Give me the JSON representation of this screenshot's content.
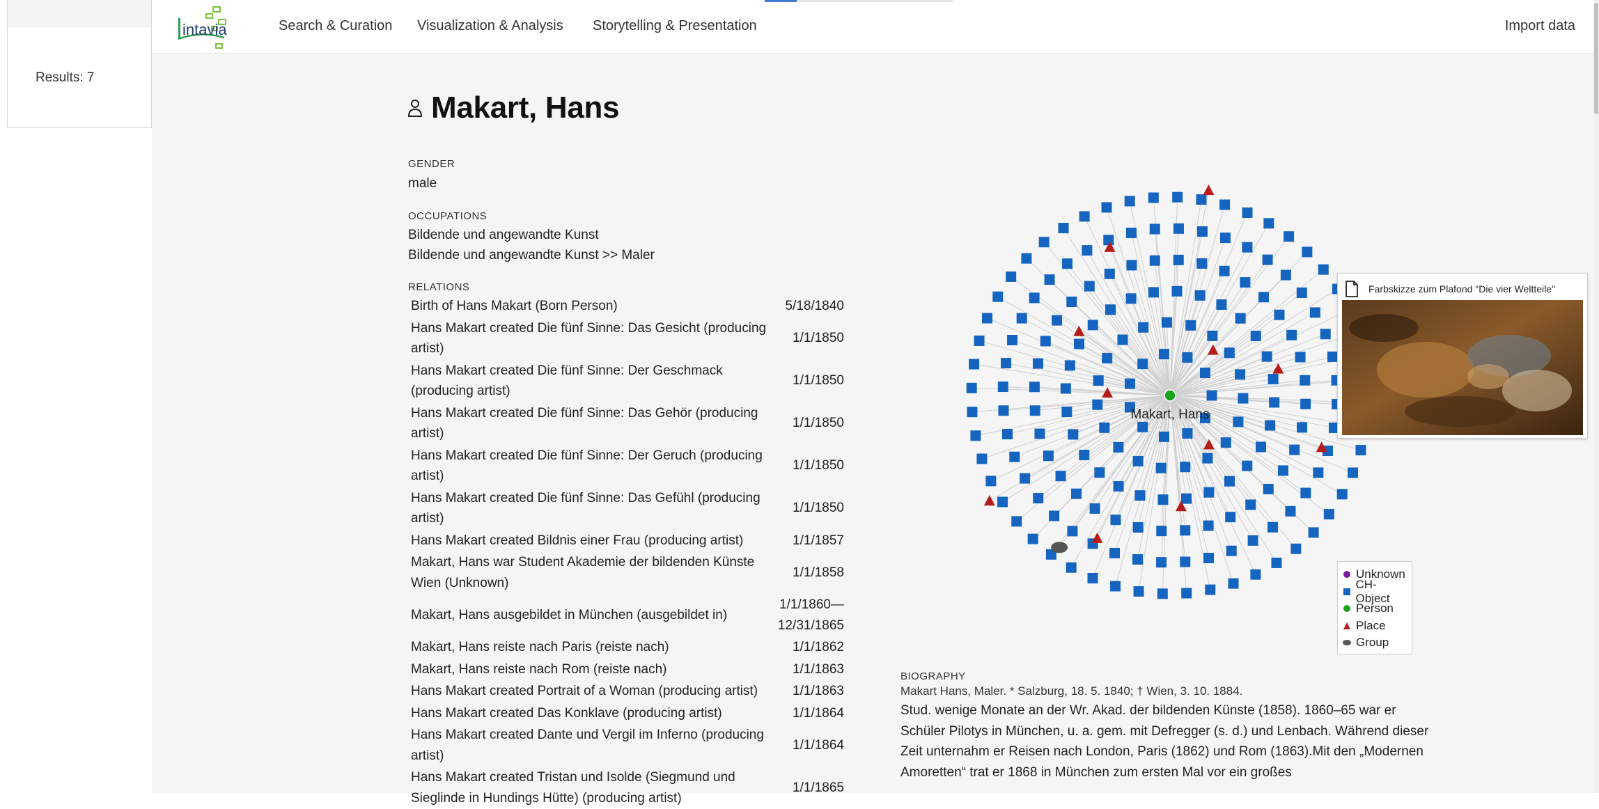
{
  "results_panel": {
    "results_text": "Results: 7"
  },
  "nav": {
    "logo_text": "intavia",
    "links": [
      "Search & Curation",
      "Visualization & Analysis",
      "Storytelling & Presentation"
    ],
    "import_label": "Import data",
    "progress_fraction": 0.17
  },
  "entity": {
    "icon": "person-icon",
    "title": "Makart, Hans",
    "gender_label": "GENDER",
    "gender": "male",
    "occupations_label": "OCCUPATIONS",
    "occupations": [
      "Bildende und angewandte Kunst",
      "Bildende und angewandte Kunst >> Maler"
    ],
    "relations_label": "RELATIONS",
    "relations": [
      {
        "text": "Birth of Hans Makart (Born Person)",
        "date": "5/18/1840"
      },
      {
        "text": "Hans Makart created Die fünf Sinne: Das Gesicht (producing artist)",
        "date": "1/1/1850"
      },
      {
        "text": "Hans Makart created Die fünf Sinne: Der Geschmack (producing artist)",
        "date": "1/1/1850"
      },
      {
        "text": "Hans Makart created Die fünf Sinne: Das Gehör (producing artist)",
        "date": "1/1/1850"
      },
      {
        "text": "Hans Makart created Die fünf Sinne: Der Geruch (producing artist)",
        "date": "1/1/1850"
      },
      {
        "text": "Hans Makart created Die fünf Sinne: Das Gefühl (producing artist)",
        "date": "1/1/1850"
      },
      {
        "text": "Hans Makart created Bildnis einer Frau (producing artist)",
        "date": "1/1/1857"
      },
      {
        "text": "Makart, Hans war Student Akademie der bildenden Künste Wien (Unknown)",
        "date": "1/1/1858"
      },
      {
        "text": "Makart, Hans ausgebildet in München (ausgebildet in)",
        "date": "1/1/1860—\n12/31/1865"
      },
      {
        "text": "Makart, Hans reiste nach Paris (reiste nach)",
        "date": "1/1/1862"
      },
      {
        "text": "Makart, Hans reiste nach Rom (reiste nach)",
        "date": "1/1/1863"
      },
      {
        "text": "Hans Makart created Portrait of a Woman (producing artist)",
        "date": "1/1/1863"
      },
      {
        "text": "Hans Makart created Das Konklave (producing artist)",
        "date": "1/1/1864"
      },
      {
        "text": "Hans Makart created Dante und Vergil im Inferno (producing artist)",
        "date": "1/1/1864"
      },
      {
        "text": "Hans Makart created Tristan und Isolde (Siegmund und Sieglinde in Hundings Hütte) (producing artist)",
        "date": "1/1/1865"
      }
    ]
  },
  "graph": {
    "center_label": "Makart, Hans",
    "colors": {
      "person": "#1aa31a",
      "ch_object": "#1565c0",
      "place": "#b71c1c",
      "group": "#555555",
      "unknown": "#7b1fa2",
      "edge": "#cfcfcf"
    },
    "counts": {
      "ch_object": 190,
      "place": 11,
      "group": 1
    },
    "legend": [
      {
        "label": "Unknown",
        "shape": "circle",
        "color": "#7b1fa2"
      },
      {
        "label": "CH-Object",
        "shape": "square",
        "color": "#1565c0"
      },
      {
        "label": "Person",
        "shape": "circle",
        "color": "#1aa31a"
      },
      {
        "label": "Place",
        "shape": "triangle",
        "color": "#b71c1c"
      },
      {
        "label": "Group",
        "shape": "ellipse",
        "color": "#555555"
      }
    ],
    "tooltip_title": "Farbskizze zum Plafond \"Die vier Weltteile\""
  },
  "biography": {
    "label": "BIOGRAPHY",
    "short": "Makart Hans, Maler. * Salzburg, 18. 5. 1840; † Wien, 3. 10. 1884.",
    "text": "Stud. wenige Monate an der Wr. Akad. der bildenden Künste (1858). 1860–65 war er Schüler Pilotys in München, u. a. gem. mit Defregger (s. d.) und Lenbach. Während dieser Zeit unternahm er Reisen nach London, Paris (1862) und Rom (1863).Mit den „Modernen Amoretten“ trat er 1868 in München zum ersten Mal vor ein großes"
  }
}
